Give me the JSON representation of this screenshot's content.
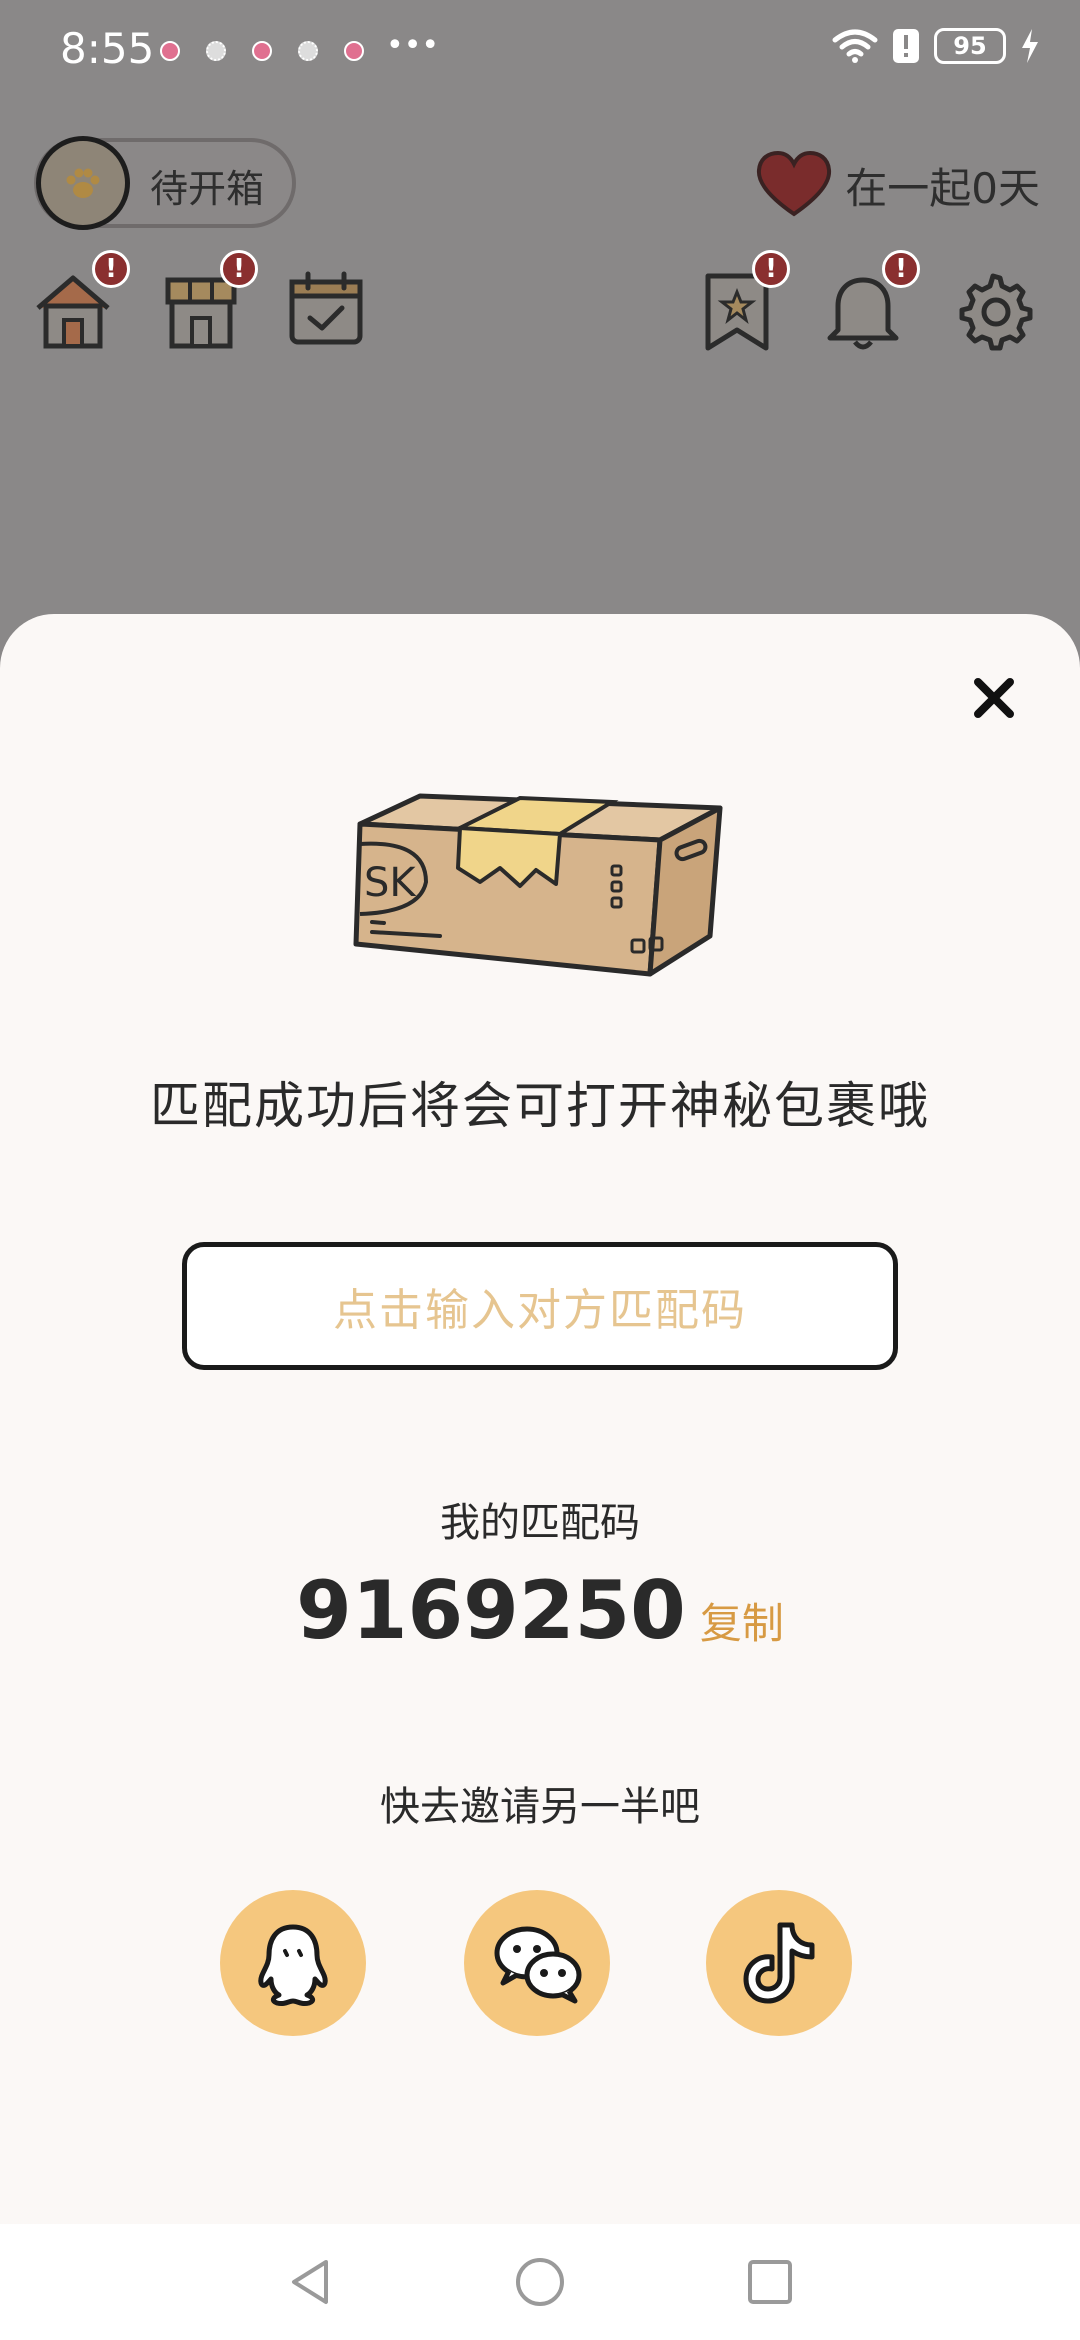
{
  "status_bar": {
    "time": "8:55",
    "battery": "95"
  },
  "header": {
    "status_label": "待开箱",
    "together_text": "在一起0天"
  },
  "header_icons": [
    {
      "name": "home-icon",
      "badge": "!"
    },
    {
      "name": "shop-icon",
      "badge": "!"
    },
    {
      "name": "calendar-check-icon",
      "badge": ""
    },
    {
      "name": "bookmark-star-icon",
      "badge": "!"
    },
    {
      "name": "bell-icon",
      "badge": "!"
    },
    {
      "name": "gear-icon",
      "badge": ""
    }
  ],
  "sheet": {
    "box_label": "SK",
    "message": "匹配成功后将会可打开神秘包裹哦",
    "input_placeholder": "点击输入对方匹配码",
    "my_code_label": "我的匹配码",
    "my_code": "9169250",
    "copy_label": "复制",
    "invite_label": "快去邀请另一半吧",
    "share_targets": [
      "qq-icon",
      "wechat-icon",
      "tiktok-icon"
    ]
  },
  "colors": {
    "overlay": "#8a8888",
    "sheet_bg": "#fbf8f6",
    "accent": "#d79a43",
    "share_bg": "#f5c77e",
    "badge": "#8a2f2f",
    "heart": "#7a2c2c"
  }
}
